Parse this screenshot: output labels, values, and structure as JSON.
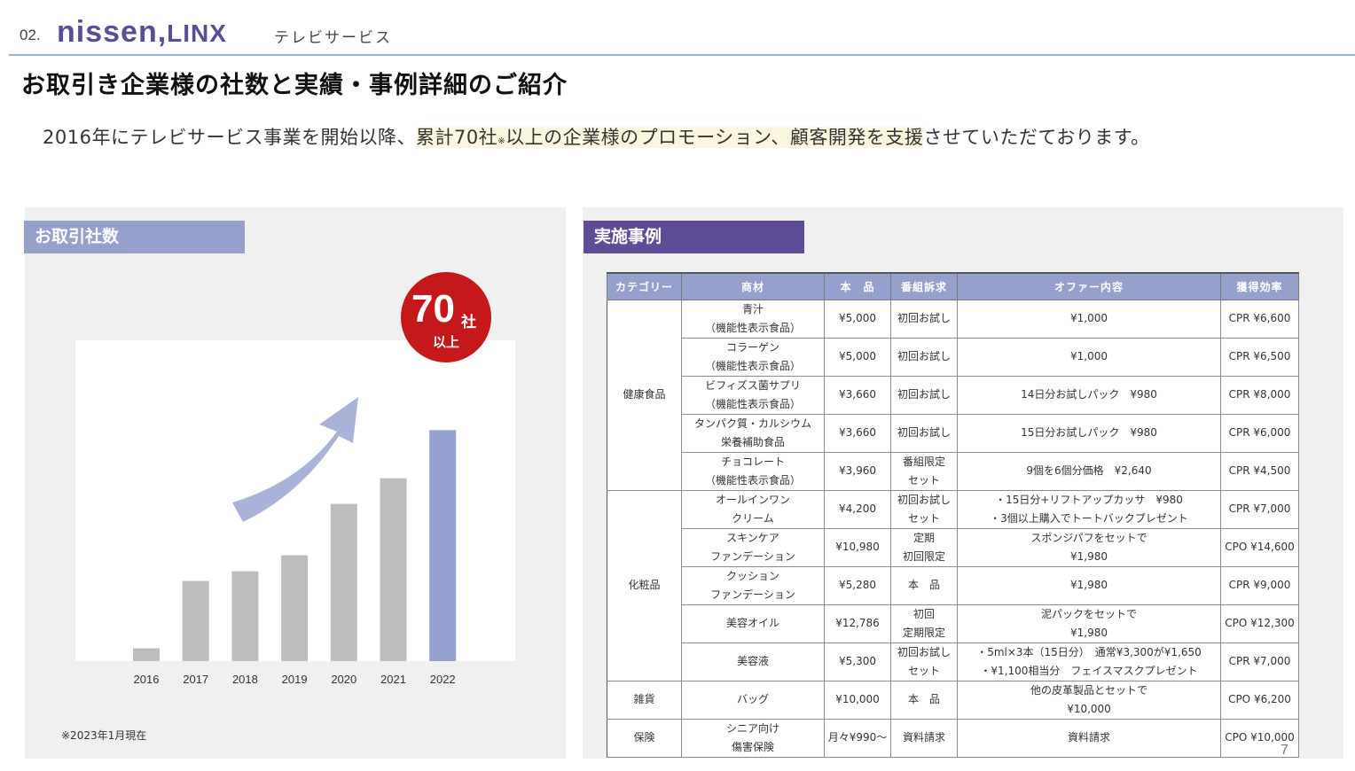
{
  "header": {
    "section_number": "02.",
    "logo_text": "nissen",
    "logo_comma": ",",
    "logo_suffix": "LINX",
    "subtitle": "テレビサービス"
  },
  "title": "お取引き企業様の社数と実績・事例詳細のご紹介",
  "lead": {
    "before": "2016年にテレビサービス事業を開始以降、",
    "highlight": "累計70社",
    "note_mark": "※",
    "highlight2": "以上の企業様のプロモーション、顧客開発を支援",
    "after": "させていただております。"
  },
  "left_panel": {
    "label": "お取引社数",
    "badge": {
      "number": "70",
      "unit": "社",
      "sub": "以上"
    },
    "footnote": "※2023年1月現在"
  },
  "chart_data": {
    "type": "bar",
    "categories": [
      "2016",
      "2017",
      "2018",
      "2019",
      "2020",
      "2021",
      "2022"
    ],
    "values": [
      4,
      25,
      28,
      33,
      49,
      57,
      72
    ],
    "highlight_index": 6,
    "ylim": [
      0,
      100
    ],
    "grid": false,
    "colors": {
      "bar": "#bdbdbd",
      "highlight": "#94a0cd",
      "arrow": "#a9b3d8"
    }
  },
  "right_panel": {
    "label": "実施事例",
    "columns": [
      "カテゴリー",
      "商材",
      "本　品",
      "番組訴求",
      "オファー内容",
      "獲得効率"
    ],
    "categories": [
      {
        "name": "健康食品",
        "rowspan": 5
      },
      {
        "name": "化粧品",
        "rowspan": 5
      },
      {
        "name": "雑貨",
        "rowspan": 1
      },
      {
        "name": "保険",
        "rowspan": 1
      }
    ],
    "rows": [
      {
        "product": "青汁\n（機能性表示食品）",
        "price": "¥5,000",
        "appeal": "初回お試し",
        "offer": "¥1,000",
        "efficiency": "CPR ¥6,600"
      },
      {
        "product": "コラーゲン\n（機能性表示食品）",
        "price": "¥5,000",
        "appeal": "初回お試し",
        "offer": "¥1,000",
        "efficiency": "CPR ¥6,500"
      },
      {
        "product": "ビフィズス菌サプリ\n（機能性表示食品）",
        "price": "¥3,660",
        "appeal": "初回お試し",
        "offer": "14日分お試しパック　¥980",
        "efficiency": "CPR ¥8,000"
      },
      {
        "product": "タンパク質・カルシウム\n栄養補助食品",
        "price": "¥3,660",
        "appeal": "初回お試し",
        "offer": "15日分お試しパック　¥980",
        "efficiency": "CPR ¥6,000"
      },
      {
        "product": "チョコレート\n（機能性表示食品）",
        "price": "¥3,960",
        "appeal": "番組限定\nセット",
        "offer": "9個を6個分価格　¥2,640",
        "efficiency": "CPR ¥4,500"
      },
      {
        "product": "オールインワン\nクリーム",
        "price": "¥4,200",
        "appeal": "初回お試し\nセット",
        "offer": "・15日分+リフトアップカッサ　¥980\n・3個以上購入でトートバックプレゼント",
        "efficiency": "CPR ¥7,000"
      },
      {
        "product": "スキンケア\nファンデーション",
        "price": "¥10,980",
        "appeal": "定期\n初回限定",
        "offer": "スポンジパフをセットで\n¥1,980",
        "efficiency": "CPO ¥14,600"
      },
      {
        "product": "クッション\nファンデーション",
        "price": "¥5,280",
        "appeal": "本　品",
        "offer": "¥1,980",
        "efficiency": "CPR ¥9,000"
      },
      {
        "product": "美容オイル",
        "price": "¥12,786",
        "appeal": "初回\n定期限定",
        "offer": "泥パックをセットで\n¥1,980",
        "efficiency": "CPO ¥12,300"
      },
      {
        "product": "美容液",
        "price": "¥5,300",
        "appeal": "初回お試し\nセット",
        "offer": "・5ml×3本（15日分）　通常¥3,300が¥1,650\n・¥1,100相当分　フェイスマスクプレゼント",
        "efficiency": "CPR ¥7,000"
      },
      {
        "product": "バッグ",
        "price": "¥10,000",
        "appeal": "本　品",
        "offer": "他の皮革製品とセットで\n¥10,000",
        "efficiency": "CPO ¥6,200"
      },
      {
        "product": "シニア向け\n傷害保険",
        "price": "月々¥990～",
        "appeal": "資料請求",
        "offer": "資料請求",
        "efficiency": "CPO ¥10,000"
      }
    ]
  },
  "page_number": "7"
}
